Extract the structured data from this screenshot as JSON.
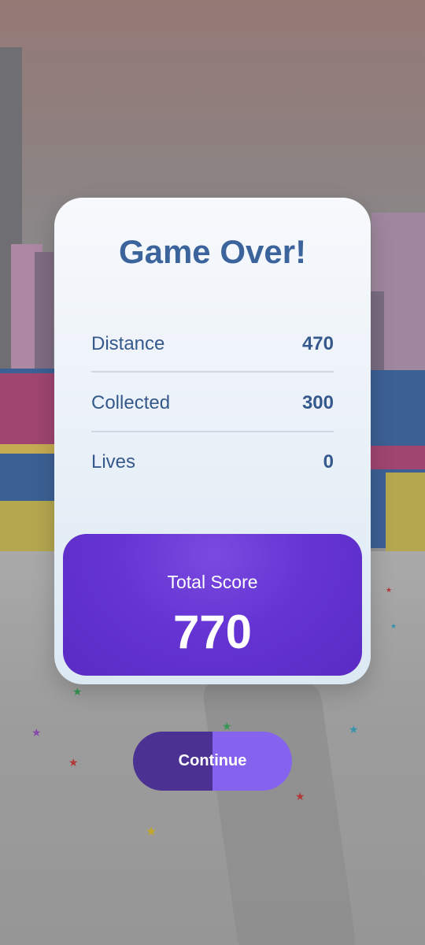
{
  "dialog": {
    "title": "Game Over!",
    "stats": [
      {
        "label": "Distance",
        "value": "470"
      },
      {
        "label": "Collected",
        "value": "300"
      },
      {
        "label": "Lives",
        "value": "0"
      }
    ],
    "total_score_label": "Total Score",
    "total_score_value": "770"
  },
  "continue_button": {
    "label": "Continue"
  },
  "colors": {
    "title": "#3c649c",
    "score_box": "#6534d3",
    "button_left": "#4b3192",
    "button_right": "#8563ee"
  }
}
